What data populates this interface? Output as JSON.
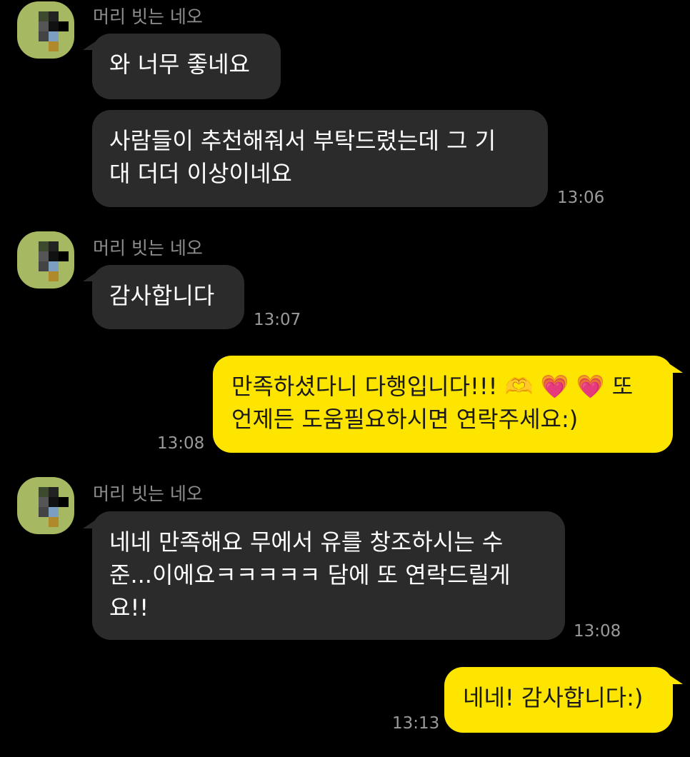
{
  "chat": {
    "sender_name": "머리 빗는 네오",
    "messages": [
      {
        "from": "other",
        "lines": [
          "와 너무 좋네요"
        ]
      },
      {
        "from": "other",
        "lines": [
          "사람들이 추천해줘서 부탁드렸는데 그 기",
          "대 더더 이상이네요"
        ],
        "time": "13:06"
      },
      {
        "from": "other",
        "lines": [
          "감사합니다"
        ],
        "time": "13:07"
      },
      {
        "from": "me",
        "lines": [
          "만족하셨다니 다행입니다!!! 🫶 💗 💗 또",
          "언제든 도움필요하시면 연락주세요:)"
        ],
        "time": "13:08"
      },
      {
        "from": "other",
        "lines": [
          "네네 만족해요 무에서 유를 창조하시는 수",
          "준...이에요ㅋㅋㅋㅋㅋ 담에 또 연락드릴게",
          "요!!"
        ],
        "time": "13:08"
      },
      {
        "from": "me",
        "lines": [
          "네네! 감사합니다:)"
        ],
        "time": "13:13"
      }
    ]
  },
  "colors": {
    "background": "#000000",
    "incoming_bubble": "#2b2b2b",
    "outgoing_bubble": "#fee500",
    "avatar_bg": "#a6b861"
  }
}
